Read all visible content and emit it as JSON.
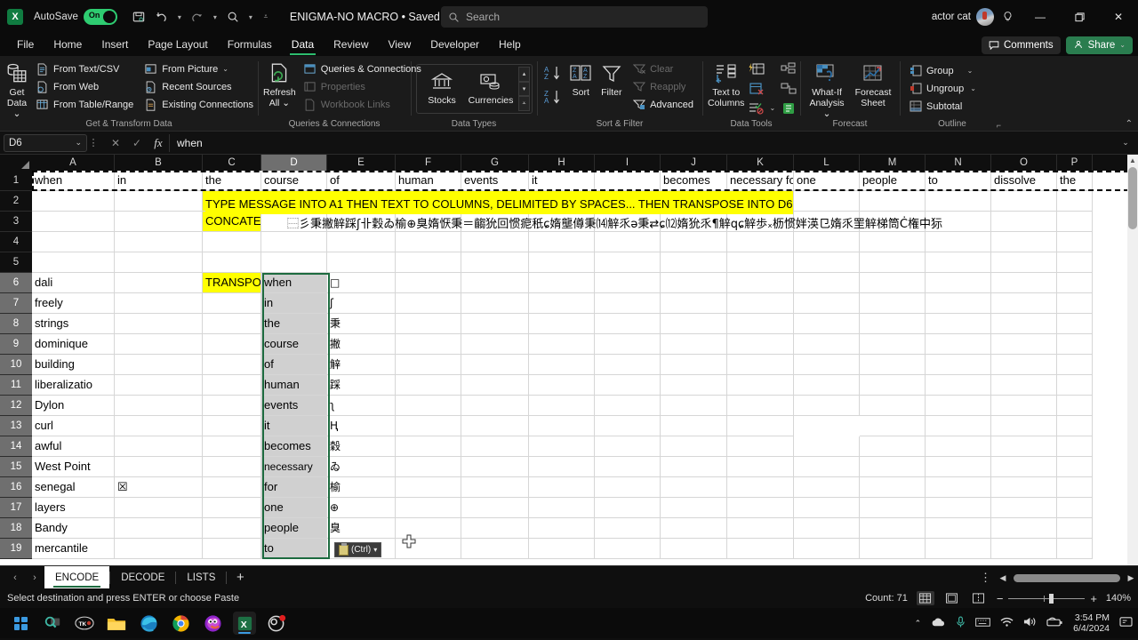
{
  "titlebar": {
    "autosave_label": "AutoSave",
    "autosave_state": "On",
    "document_title": "ENIGMA-NO MACRO • Saved",
    "search_placeholder": "Search",
    "account_name": "actor cat",
    "qat": [
      "save-icon",
      "undo-icon",
      "redo-icon",
      "search-small-icon",
      "customize-icon"
    ]
  },
  "ribbon": {
    "tabs": [
      {
        "label": "File"
      },
      {
        "label": "Home"
      },
      {
        "label": "Insert"
      },
      {
        "label": "Page Layout"
      },
      {
        "label": "Formulas"
      },
      {
        "label": "Data"
      },
      {
        "label": "Review"
      },
      {
        "label": "View"
      },
      {
        "label": "Developer"
      },
      {
        "label": "Help"
      }
    ],
    "active_tab": "Data",
    "comments_label": "Comments",
    "share_label": "Share",
    "groups": [
      {
        "name": "Get & Transform Data",
        "big": {
          "line1": "Get",
          "line2": "Data"
        },
        "items": [
          {
            "label": "From Text/CSV"
          },
          {
            "label": "From Web"
          },
          {
            "label": "From Table/Range"
          },
          {
            "label": "From Picture"
          },
          {
            "label": "Recent Sources"
          },
          {
            "label": "Existing Connections"
          }
        ]
      },
      {
        "name": "Queries & Connections",
        "big": {
          "line1": "Refresh",
          "line2": "All"
        },
        "items": [
          {
            "label": "Queries & Connections",
            "disabled": false
          },
          {
            "label": "Properties",
            "disabled": true
          },
          {
            "label": "Workbook Links",
            "disabled": true
          }
        ]
      },
      {
        "name": "Data Types",
        "items": [
          {
            "label": "Stocks"
          },
          {
            "label": "Currencies"
          }
        ]
      },
      {
        "name": "Sort & Filter",
        "items": [
          {
            "label": "Sort"
          },
          {
            "label": "Filter"
          },
          {
            "label": "Clear",
            "disabled": true
          },
          {
            "label": "Reapply",
            "disabled": true
          },
          {
            "label": "Advanced",
            "disabled": false
          }
        ]
      },
      {
        "name": "Data Tools",
        "items": [
          {
            "label": "Text to Columns"
          }
        ]
      },
      {
        "name": "Forecast",
        "items": [
          {
            "label": "What-If Analysis"
          },
          {
            "label": "Forecast Sheet"
          }
        ]
      },
      {
        "name": "Outline",
        "items": [
          {
            "label": "Group"
          },
          {
            "label": "Ungroup"
          },
          {
            "label": "Subtotal"
          }
        ]
      }
    ]
  },
  "formula_bar": {
    "name_box": "D6",
    "formula_value": "when",
    "cancel_icon": "close-icon",
    "enter_icon": "check-icon",
    "fx_icon": "fx-icon"
  },
  "grid": {
    "columns": [
      {
        "label": "A",
        "width": 93
      },
      {
        "label": "B",
        "width": 99
      },
      {
        "label": "C",
        "width": 66
      },
      {
        "label": "D",
        "width": 74
      },
      {
        "label": "E",
        "width": 77
      },
      {
        "label": "F",
        "width": 74
      },
      {
        "label": "G",
        "width": 76
      },
      {
        "label": "H",
        "width": 74
      },
      {
        "label": "I",
        "width": 74
      },
      {
        "label": "J",
        "width": 75
      },
      {
        "label": "K",
        "width": 75
      },
      {
        "label": "L",
        "width": 74
      },
      {
        "label": "M",
        "width": 74
      },
      {
        "label": "N",
        "width": 74
      },
      {
        "label": "O",
        "width": 74
      },
      {
        "label": "P",
        "width": 40
      }
    ],
    "selected_column": "D",
    "rows": [
      "1",
      "2",
      "3",
      "4",
      "5",
      "6",
      "7",
      "8",
      "9",
      "10",
      "11",
      "12",
      "13",
      "14",
      "15",
      "16",
      "17",
      "18",
      "19"
    ],
    "selected_rows": [
      "6",
      "7",
      "8",
      "9",
      "10",
      "11",
      "12",
      "13",
      "14",
      "15",
      "16",
      "17",
      "18",
      "19"
    ],
    "row1": [
      "when",
      "in",
      "",
      "the",
      "course",
      "of",
      "",
      "human",
      "events",
      "it",
      "",
      "becomes",
      "necessary for",
      "",
      "one",
      "people",
      "to",
      "",
      "dissolve",
      "the"
    ],
    "row2_note": "TYPE MESSAGE INTO A1 THEN TEXT TO COLUMNS, DELIMITED BY SPACES... THEN TRANSPOSE INTO D6",
    "row3_label": "CONCATE",
    "row3_value": "⿱彡秉撇觪踩ʃ卝穀ゐ榆⊕臭媠恹秉＝齺狁回惯痆秖ɕ媠壟僔秉⒁觪乑ə秉⇄ɕ⑿媠狁乑¶觪qɕ觪歩ₓ枥惯姅渶㔾媠乑罜觪梯筒Ċ権中狋",
    "transpose_label": "TRANSPOSE",
    "col_a": [
      "dali",
      "freely",
      "strings",
      "dominique",
      "building",
      "liberalizatio",
      "Dylon",
      "curl",
      "awful",
      "West Point",
      "senegal",
      "layers",
      "Bandy",
      "mercantile"
    ],
    "col_b": [
      "\u0001",
      "",
      "\u0001",
      "\u0001",
      "\u0001",
      "\u0001",
      "\u0001",
      "\u0001",
      "",
      "\u0001",
      "☒",
      "\u0001",
      "\u0001",
      "\u0001"
    ],
    "col_d": [
      "when",
      "in",
      "the",
      "course",
      "of",
      "human",
      "events",
      "it",
      "becomes",
      "necessary",
      "for",
      "one",
      "people",
      "to"
    ],
    "col_e": [
      "□",
      "ʃ",
      "秉",
      "撇",
      "觪",
      "踩",
      "ʅ",
      "Ⱨ",
      "穀",
      "ゐ",
      "榆",
      "⊕",
      "臭",
      ""
    ],
    "paste_tag_label": "(Ctrl)"
  },
  "sheet_tabs": {
    "tabs": [
      "ENCODE",
      "DECODE",
      "LISTS"
    ],
    "active": "ENCODE",
    "add_label": "+"
  },
  "status_bar": {
    "message": "Select destination and press ENTER or choose Paste",
    "count_label": "Count: 71",
    "zoom_label": "140%"
  },
  "taskbar": {
    "icons": [
      "start-icon",
      "search-icon",
      "tko-icon",
      "file-explorer-icon",
      "edge-icon",
      "chrome-icon",
      "firefox-icon",
      "excel-icon",
      "obs-icon"
    ],
    "time": "3:54 PM",
    "date": "6/4/2024"
  },
  "colors": {
    "accent_green": "#107c41",
    "highlight_yellow": "#ffff00",
    "selection_green": "#1d6b3f",
    "share_green": "#2a7d4f"
  }
}
